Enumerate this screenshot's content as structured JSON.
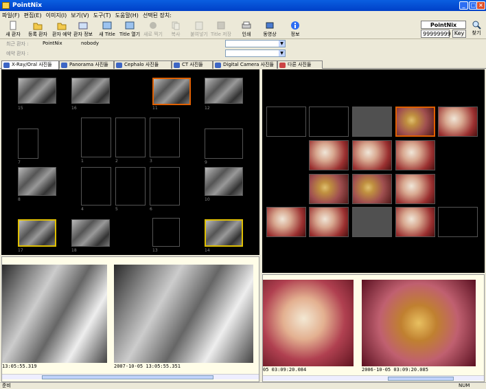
{
  "window": {
    "title": "PointNix"
  },
  "menu": [
    "파일(F)",
    "편집(E)",
    "이미지(I)",
    "보기(V)",
    "도구(T)",
    "도움말(H)",
    "선택된 장치:"
  ],
  "toolbar": {
    "buttons": [
      {
        "label": "새 환자",
        "icon": "new-patient-icon",
        "enabled": true
      },
      {
        "label": "등록 환자",
        "icon": "registered-patient-icon",
        "enabled": true
      },
      {
        "label": "환자 예약",
        "icon": "reservation-icon",
        "enabled": true
      },
      {
        "label": "환자 정보",
        "icon": "patient-info-icon",
        "enabled": true
      },
      {
        "label": "새 Title",
        "icon": "new-title-icon",
        "enabled": true
      },
      {
        "label": "Title 열기",
        "icon": "open-title-icon",
        "enabled": true
      },
      {
        "label": "새로 찍기",
        "icon": "capture-icon",
        "enabled": false
      },
      {
        "label": "복사",
        "icon": "copy-icon",
        "enabled": false
      },
      {
        "label": "붙여넣기",
        "icon": "paste-icon",
        "enabled": false
      },
      {
        "label": "Title 저장",
        "icon": "save-icon",
        "enabled": false
      },
      {
        "label": "인쇄",
        "icon": "print-icon",
        "enabled": true
      },
      {
        "label": "동영상",
        "icon": "video-icon",
        "enabled": true
      },
      {
        "label": "정보",
        "icon": "info-icon",
        "enabled": true
      }
    ],
    "pointnix_label": "PointNix",
    "id_value": "99999999",
    "key_label": "Key",
    "find_label": "찾기"
  },
  "patient": {
    "recent_label": "최근 환자 :",
    "recent_name": "PointNix",
    "recent_user": "nobody",
    "reserved_label": "예약 환자 :"
  },
  "tabs": [
    "X-Ray/Oral 사진들",
    "Panorama 사진들",
    "Cephalo 사진들",
    "CT 사진들",
    "Digital Camera 사진들",
    "다른 사진들"
  ],
  "xray_slots": [
    "15",
    "16",
    "11",
    "12",
    "7",
    "1",
    "2",
    "3",
    "9",
    "8",
    "4",
    "5",
    "6",
    "10",
    "17",
    "18",
    "13",
    "14"
  ],
  "left_viewer": {
    "timestamps": [
      "13:05:55.319",
      "2007-10-05 13:05:55.351"
    ]
  },
  "right_viewer": {
    "timestamps": [
      "05 03:09:20.084",
      "2006-10-05 03:09:20.085"
    ]
  },
  "status": {
    "left": "준비",
    "right": "NUM"
  }
}
